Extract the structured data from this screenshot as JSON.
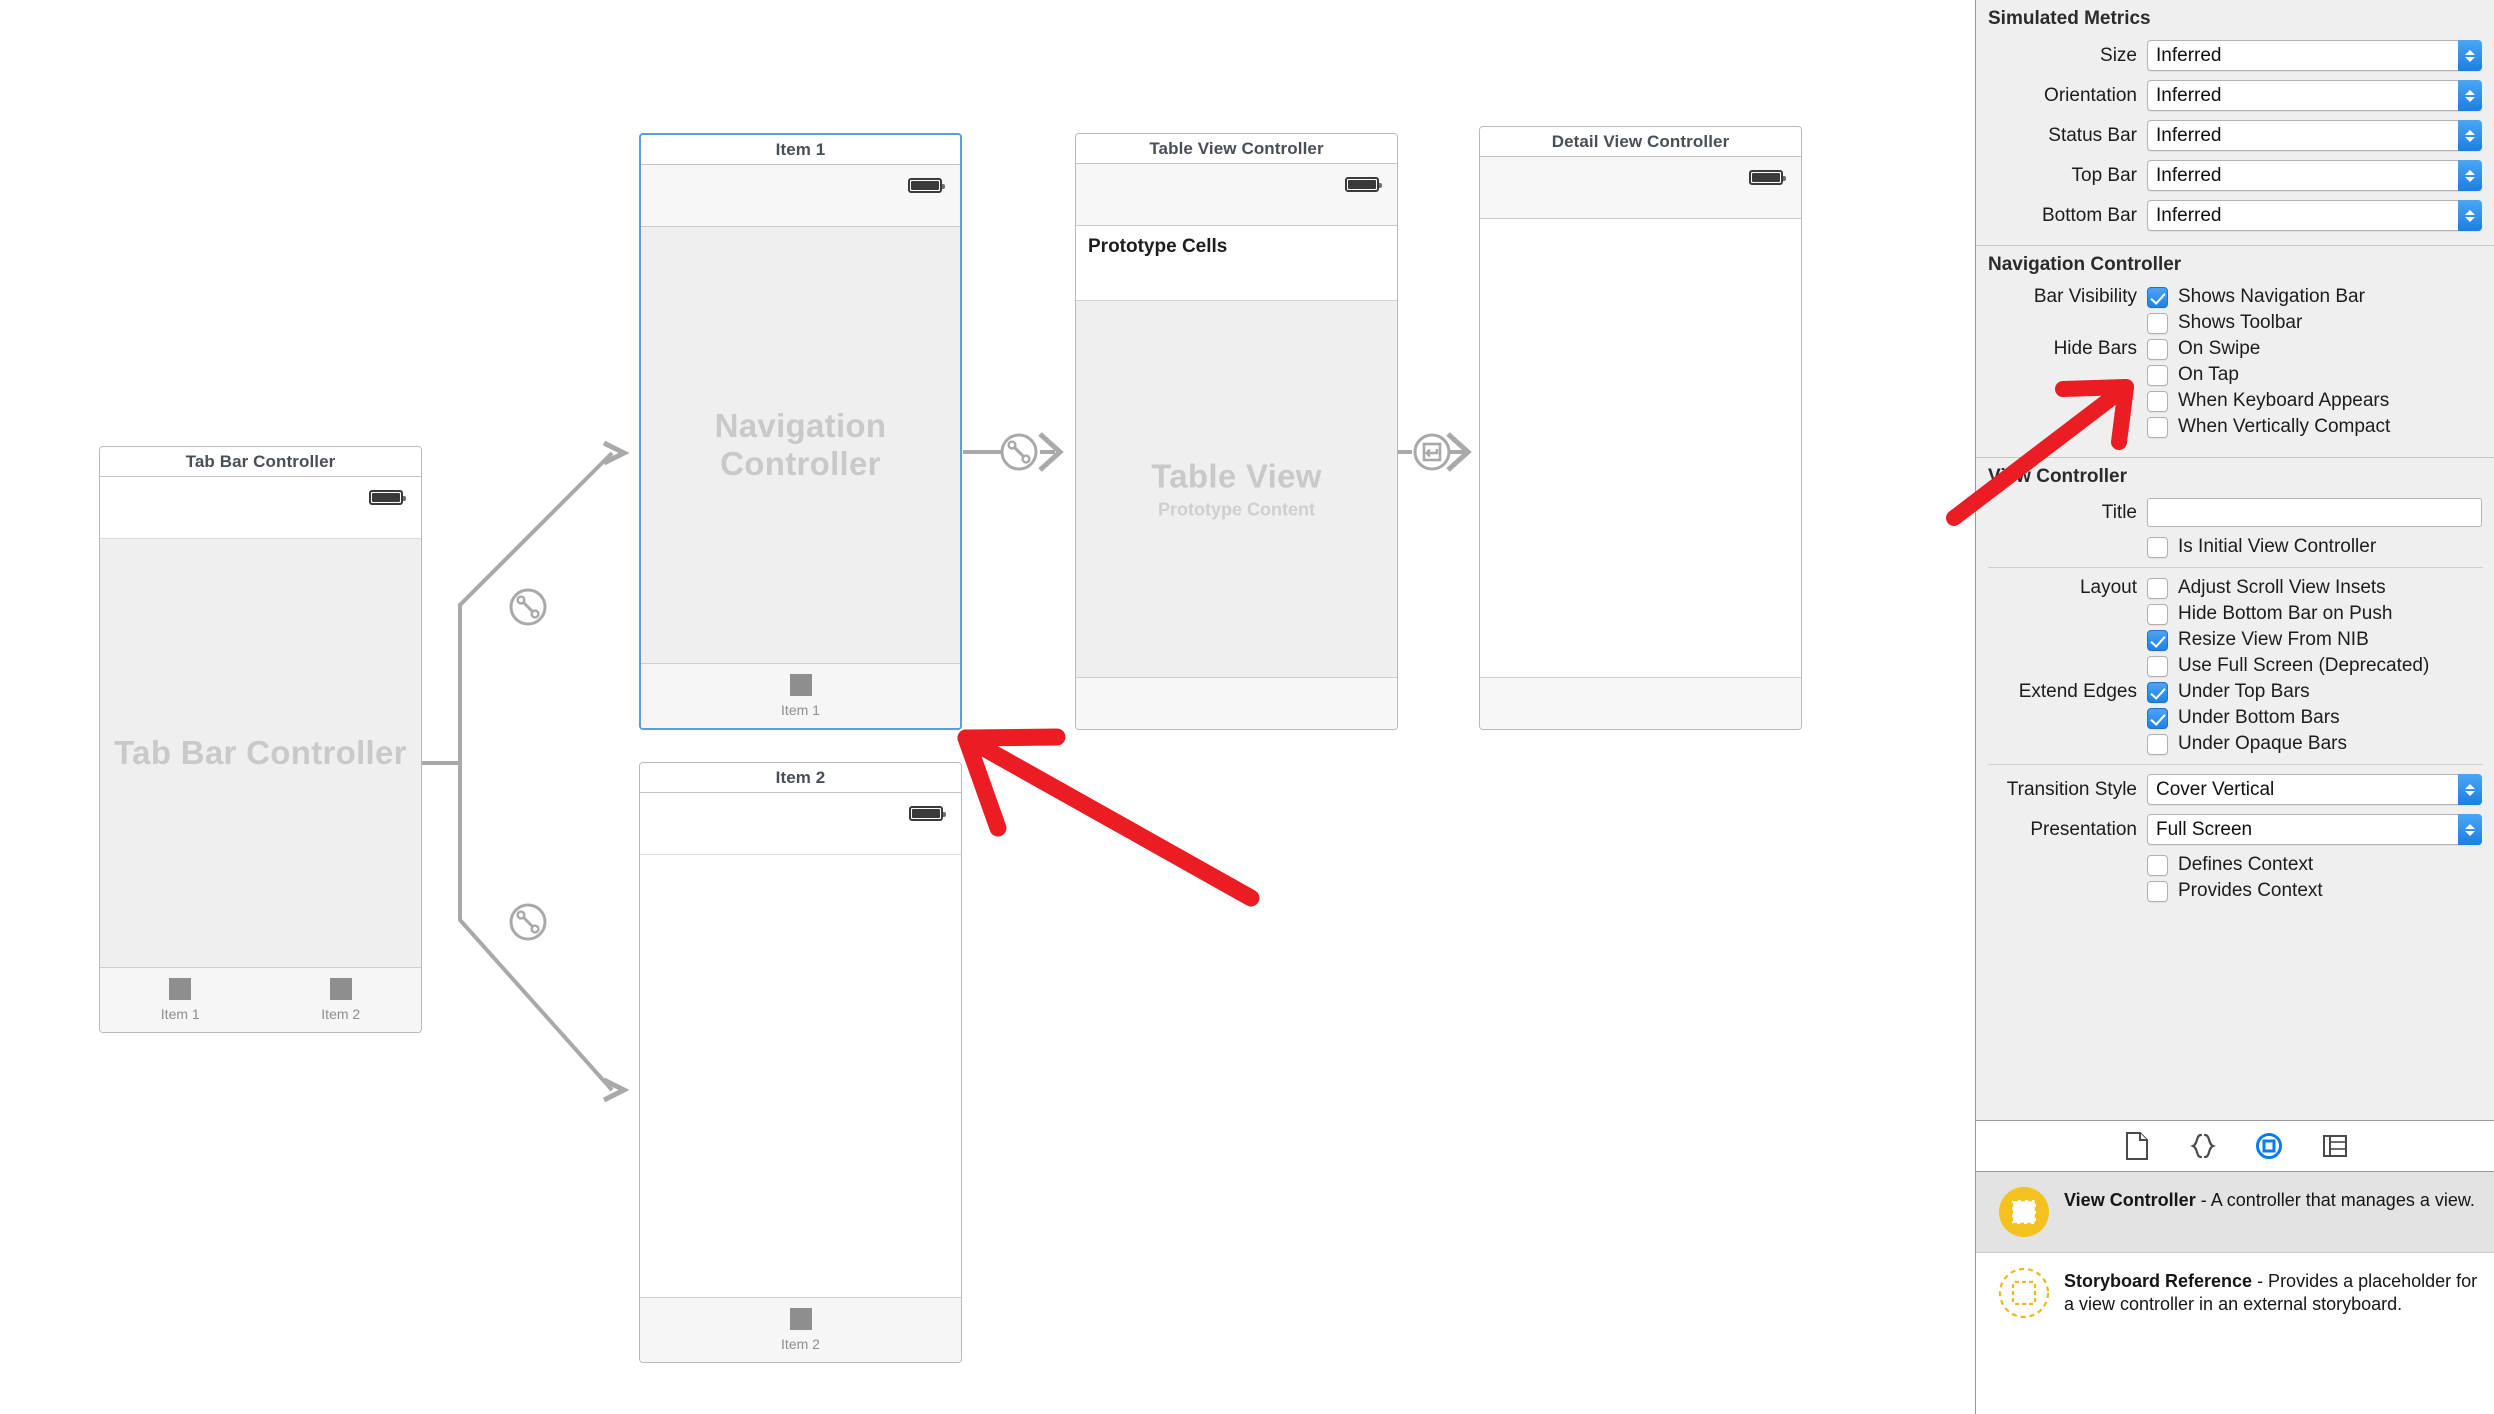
{
  "canvas": {
    "scenes": [
      {
        "id": "tab-bar-controller",
        "title": "Tab Bar Controller",
        "placeholder": "Tab Bar Controller",
        "tabs": [
          {
            "label": "Item 1"
          },
          {
            "label": "Item 2"
          }
        ]
      },
      {
        "id": "item-1",
        "title": "Item 1",
        "placeholder": "Navigation Controller",
        "selected": true,
        "tabs": [
          {
            "label": "Item 1"
          }
        ]
      },
      {
        "id": "table-view-controller",
        "title": "Table View Controller",
        "prototype_cells_label": "Prototype Cells",
        "placeholder": "Table View",
        "placeholder_sub": "Prototype Content"
      },
      {
        "id": "detail-view-controller",
        "title": "Detail View Controller"
      },
      {
        "id": "item-2",
        "title": "Item 2",
        "tabs": [
          {
            "label": "Item 2"
          }
        ]
      }
    ],
    "segues": [
      {
        "id": "tab-to-item1",
        "kind": "relationship"
      },
      {
        "id": "tab-to-item2",
        "kind": "relationship"
      },
      {
        "id": "nav-to-table",
        "kind": "relationship"
      },
      {
        "id": "table-to-detail",
        "kind": "show"
      }
    ]
  },
  "inspector": {
    "simulated_metrics": {
      "title": "Simulated Metrics",
      "rows": [
        {
          "label": "Size",
          "value": "Inferred"
        },
        {
          "label": "Orientation",
          "value": "Inferred"
        },
        {
          "label": "Status Bar",
          "value": "Inferred"
        },
        {
          "label": "Top Bar",
          "value": "Inferred"
        },
        {
          "label": "Bottom Bar",
          "value": "Inferred"
        }
      ]
    },
    "navigation_controller": {
      "title": "Navigation Controller",
      "bar_visibility_label": "Bar Visibility",
      "bar_visibility": [
        {
          "label": "Shows Navigation Bar",
          "checked": true
        },
        {
          "label": "Shows Toolbar",
          "checked": false
        }
      ],
      "hide_bars_label": "Hide Bars",
      "hide_bars": [
        {
          "label": "On Swipe",
          "checked": false
        },
        {
          "label": "On Tap",
          "checked": false
        },
        {
          "label": "When Keyboard Appears",
          "checked": false
        },
        {
          "label": "When Vertically Compact",
          "checked": false
        }
      ]
    },
    "view_controller": {
      "title": "View Controller",
      "title_label": "Title",
      "title_value": "",
      "is_initial_label": "Is Initial View Controller",
      "is_initial_checked": false,
      "layout_label": "Layout",
      "layout": [
        {
          "label": "Adjust Scroll View Insets",
          "checked": false
        },
        {
          "label": "Hide Bottom Bar on Push",
          "checked": false
        },
        {
          "label": "Resize View From NIB",
          "checked": true
        },
        {
          "label": "Use Full Screen (Deprecated)",
          "checked": false
        }
      ],
      "extend_edges_label": "Extend Edges",
      "extend_edges": [
        {
          "label": "Under Top Bars",
          "checked": true
        },
        {
          "label": "Under Bottom Bars",
          "checked": true
        },
        {
          "label": "Under Opaque Bars",
          "checked": false
        }
      ],
      "transition_style_label": "Transition Style",
      "transition_style_value": "Cover Vertical",
      "presentation_label": "Presentation",
      "presentation_value": "Full Screen",
      "context": [
        {
          "label": "Defines Context",
          "checked": false
        },
        {
          "label": "Provides Context",
          "checked": false
        }
      ]
    },
    "tabs": [
      {
        "name": "file-inspector-icon",
        "active": false
      },
      {
        "name": "code-snippet-library-icon",
        "active": false
      },
      {
        "name": "object-library-icon",
        "active": true
      },
      {
        "name": "media-library-icon",
        "active": false
      }
    ],
    "library": [
      {
        "name": "View Controller",
        "description": " - A controller that manages a view.",
        "selected": true,
        "icon": "filled-view-controller-icon"
      },
      {
        "name": "Storyboard Reference",
        "description": " - Provides a placeholder for a view controller in an external storyboard.",
        "selected": false,
        "icon": "dashed-storyboard-reference-icon"
      }
    ]
  },
  "annotations": {
    "arrow_to_scene": "red-arrow-pointing-at-item-1-scene",
    "arrow_to_checkbox": "red-arrow-pointing-at-shows-toolbar-checkbox"
  },
  "colors": {
    "accent": "#1d82e8",
    "annotation": "#ec1c24",
    "selection_border": "#5c9ddb",
    "library_icon": "#f5c11e"
  }
}
